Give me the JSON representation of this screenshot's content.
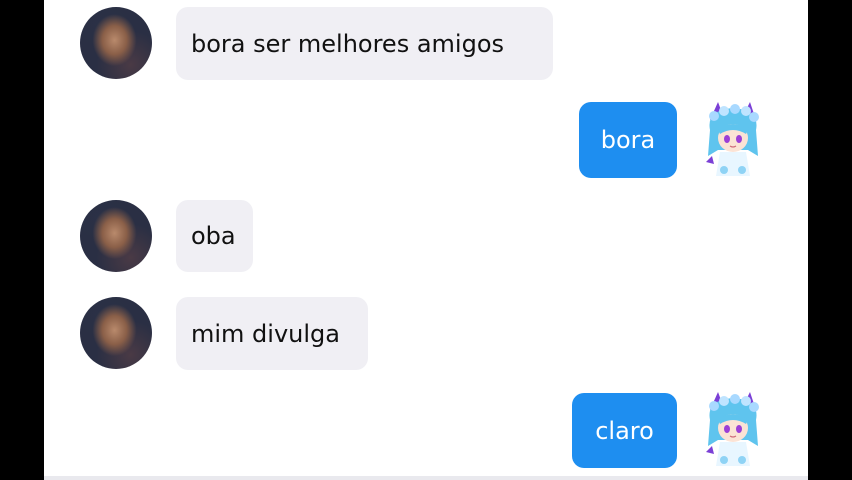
{
  "theme": {
    "incoming_bubble_color": "#f0eff4",
    "outgoing_bubble_color": "#1e8ef0"
  },
  "messages": [
    {
      "sender": "friend",
      "avatar_icon": "profile-photo",
      "text": "bora ser melhores amigos"
    },
    {
      "sender": "me",
      "avatar_icon": "anime-character-avatar",
      "text": "bora"
    },
    {
      "sender": "friend",
      "avatar_icon": "profile-photo",
      "text": "oba"
    },
    {
      "sender": "friend",
      "avatar_icon": "profile-photo",
      "text": "mim divulga"
    },
    {
      "sender": "me",
      "avatar_icon": "anime-character-avatar",
      "text": "claro"
    }
  ]
}
